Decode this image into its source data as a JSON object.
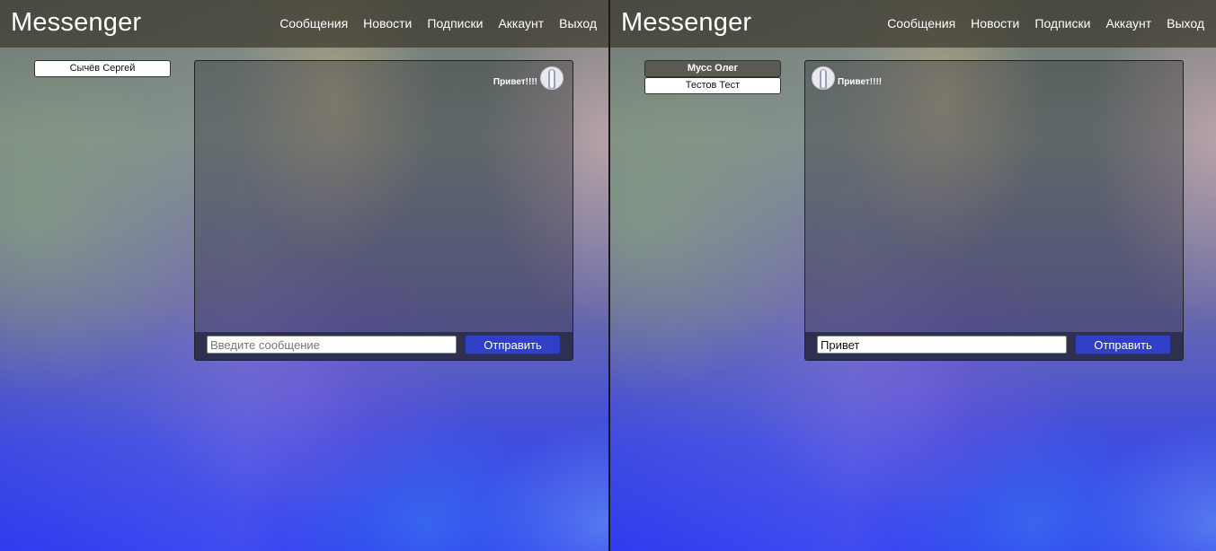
{
  "app": {
    "brand": "Messenger"
  },
  "nav": [
    "Сообщения",
    "Новости",
    "Подписки",
    "Аккаунт",
    "Выход"
  ],
  "left": {
    "contacts": [
      "Сычёв Сергей"
    ],
    "messages": [
      {
        "text": "Привет!!!!",
        "side": "right"
      }
    ],
    "input": {
      "value": "",
      "placeholder": "Введите сообщение"
    },
    "send_label": "Отправить"
  },
  "right": {
    "contacts": [
      "Мусс Олег",
      "Тестов Тест"
    ],
    "active_contact": "Мусс Олег",
    "messages": [
      {
        "text": "Привет!!!!",
        "side": "left"
      }
    ],
    "input": {
      "value": "Привет",
      "placeholder": "Введите сообщение"
    },
    "send_label": "Отправить"
  },
  "icons": {
    "avatar": "user-silhouette-icon"
  }
}
